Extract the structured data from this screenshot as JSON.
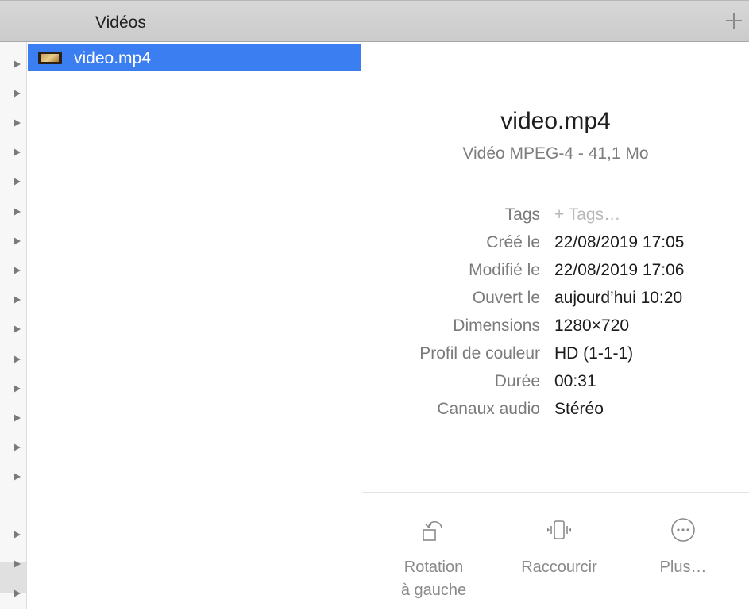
{
  "tab": {
    "title": "Vidéos",
    "add_icon": "plus-icon"
  },
  "file_list": {
    "items": [
      {
        "name": "video.mp4",
        "icon": "video-file-icon",
        "selected": true
      }
    ]
  },
  "preview": {
    "title": "video.mp4",
    "subtitle": "Vidéo MPEG-4 - 41,1 Mo",
    "metadata": [
      {
        "label": "Tags",
        "value": "+ Tags…"
      },
      {
        "label": "Créé le",
        "value": "22/08/2019 17:05"
      },
      {
        "label": "Modifié le",
        "value": "22/08/2019 17:06"
      },
      {
        "label": "Ouvert le",
        "value": "aujourd’hui 10:20"
      },
      {
        "label": "Dimensions",
        "value": "1280×720"
      },
      {
        "label": "Profil de couleur",
        "value": "HD (1-1-1)"
      },
      {
        "label": "Durée",
        "value": "00:31"
      },
      {
        "label": "Canaux audio",
        "value": "Stéréo"
      }
    ],
    "actions": [
      {
        "label": "Rotation\nà gauche",
        "icon": "rotate-left-icon"
      },
      {
        "label": "Raccourcir",
        "icon": "trim-icon"
      },
      {
        "label": "Plus…",
        "icon": "more-icon"
      }
    ]
  },
  "colors": {
    "selection": "#3b7ef2",
    "label_gray": "#7b7b7b",
    "tab_bar": "#d2d2d2"
  }
}
